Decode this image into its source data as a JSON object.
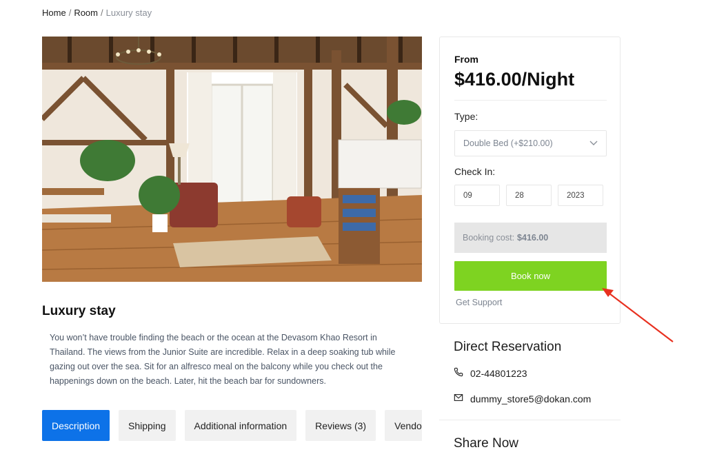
{
  "breadcrumb": {
    "items": [
      "Home",
      "Room"
    ],
    "separator": "/",
    "current": "Luxury stay"
  },
  "product": {
    "title": "Luxury stay",
    "description": "You won’t have trouble finding the beach or the ocean at the Devasom Khao Resort in Thailand. The views from the Junior Suite are incredible. Relax in a deep soaking tub while gazing out over the sea. Sit for an alfresco meal on the balcony while you check out the happenings down on the beach. Later, hit the beach bar for sundowners."
  },
  "tabs": [
    {
      "label": "Description",
      "active": true
    },
    {
      "label": "Shipping",
      "active": false
    },
    {
      "label": "Additional information",
      "active": false
    },
    {
      "label": "Reviews (3)",
      "active": false
    },
    {
      "label": "Vendor Info",
      "active": false
    }
  ],
  "booking": {
    "from_label": "From",
    "price": "$416.00/Night",
    "type_label": "Type:",
    "type_value": "Double Bed (+$210.00)",
    "checkin_label": "Check In:",
    "date": {
      "month": "09",
      "day": "28",
      "year": "2023"
    },
    "cost_label": "Booking cost:",
    "cost_value": "$416.00",
    "book_label": "Book now",
    "support_label": "Get Support"
  },
  "reservation": {
    "title": "Direct Reservation",
    "phone": "02-44801223",
    "email": "dummy_store5@dokan.com"
  },
  "share": {
    "title": "Share Now"
  },
  "colors": {
    "accent_blue": "#0d72e8",
    "book_green": "#7ed321",
    "annotation_red": "#e8301f"
  }
}
